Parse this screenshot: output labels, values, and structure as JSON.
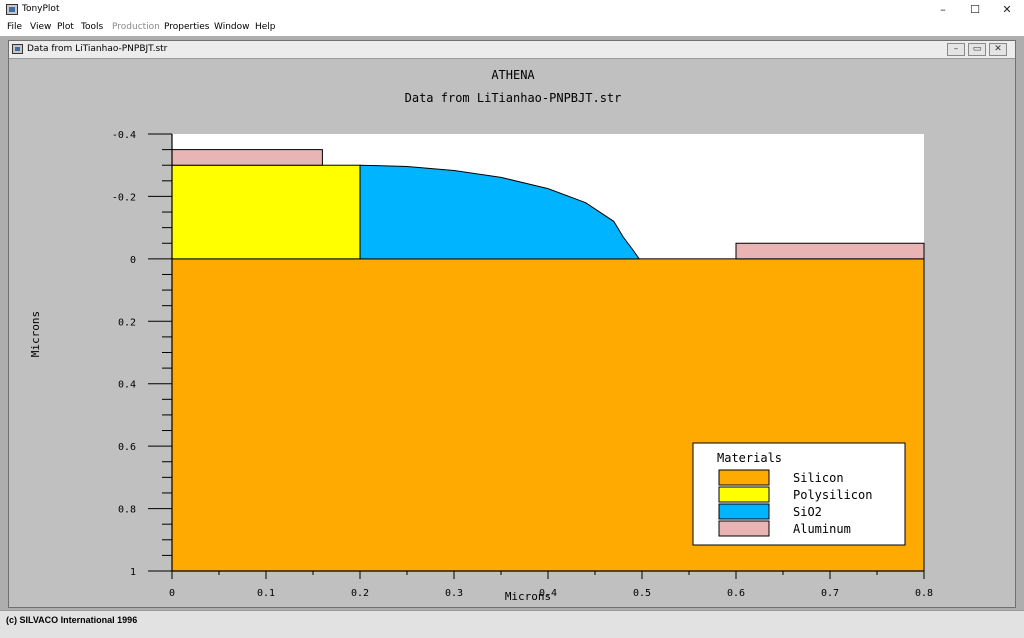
{
  "app": {
    "title": "TonyPlot"
  },
  "menu": {
    "items": [
      {
        "label": "File",
        "enabled": true
      },
      {
        "label": "View",
        "enabled": true
      },
      {
        "label": "Plot",
        "enabled": true
      },
      {
        "label": "Tools",
        "enabled": true
      },
      {
        "label": "Production",
        "enabled": false
      },
      {
        "label": "Properties",
        "enabled": true
      },
      {
        "label": "Window",
        "enabled": true
      },
      {
        "label": "Help",
        "enabled": true
      }
    ]
  },
  "window_controls": {
    "minimize": "–",
    "maximize": "☐",
    "close": "✕"
  },
  "child_window": {
    "title": "Data from LiTianhao-PNPBJT.str"
  },
  "plot": {
    "title": "ATHENA",
    "subtitle": "Data from LiTianhao-PNPBJT.str",
    "xlabel": "Microns",
    "ylabel": "Microns",
    "x_ticks": [
      "0",
      "0.1",
      "0.2",
      "0.3",
      "0.4",
      "0.5",
      "0.6",
      "0.7",
      "0.8"
    ],
    "y_ticks": [
      "-0.4",
      "-0.2",
      "0",
      "0.2",
      "0.4",
      "0.6",
      "0.8",
      "1"
    ],
    "legend": {
      "title": "Materials",
      "items": [
        {
          "label": "Silicon",
          "color": "#ffaa00"
        },
        {
          "label": "Polysilicon",
          "color": "#ffff00"
        },
        {
          "label": "SiO2",
          "color": "#00b4ff"
        },
        {
          "label": "Aluminum",
          "color": "#e8b4b4"
        }
      ]
    },
    "regions": {
      "silicon": {
        "x": [
          0,
          0.8
        ],
        "y": [
          0,
          1
        ]
      },
      "polysilicon": {
        "x": [
          0,
          0.2
        ],
        "y": [
          -0.3,
          0
        ]
      },
      "aluminum_left": {
        "x": [
          0,
          0.16
        ],
        "y": [
          -0.35,
          -0.3
        ]
      },
      "aluminum_right": {
        "x": [
          0.6,
          0.8
        ],
        "y": [
          -0.05,
          0
        ]
      },
      "sio2_curve": [
        [
          0.2,
          -0.3
        ],
        [
          0.25,
          -0.296
        ],
        [
          0.3,
          -0.283
        ],
        [
          0.35,
          -0.261
        ],
        [
          0.4,
          -0.225
        ],
        [
          0.44,
          -0.18
        ],
        [
          0.47,
          -0.12
        ],
        [
          0.48,
          -0.07
        ],
        [
          0.49,
          -0.03
        ],
        [
          0.497,
          0
        ]
      ]
    }
  },
  "status": {
    "text": "(c) SILVACO International 1996"
  }
}
